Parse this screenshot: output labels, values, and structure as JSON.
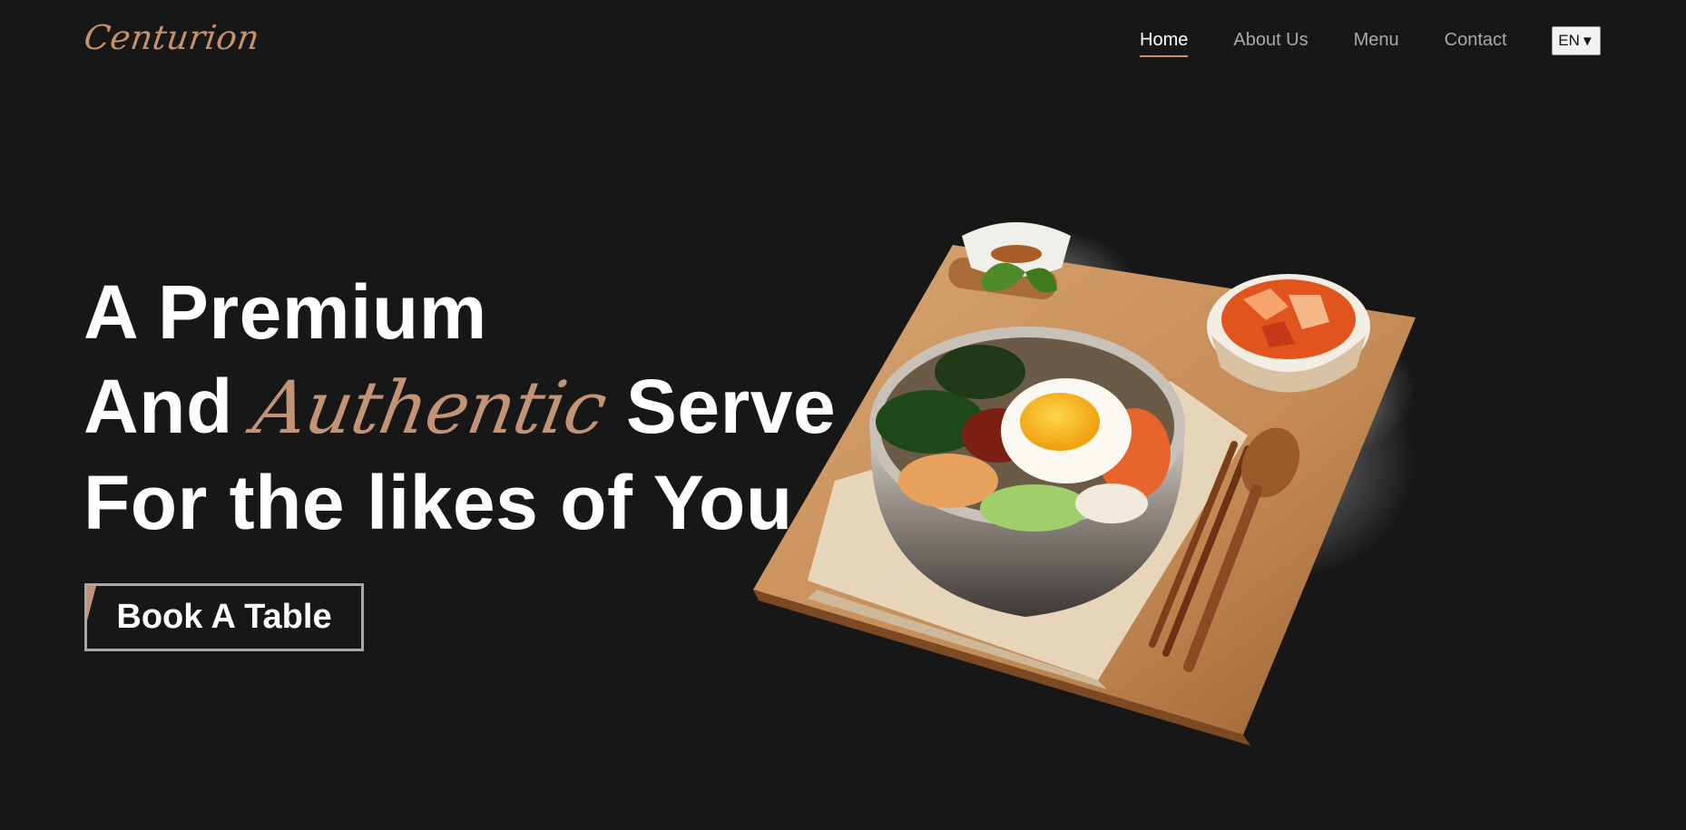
{
  "brand": {
    "name": "Centurion",
    "accent_color": "#c8916a",
    "background_color": "#171717"
  },
  "nav": {
    "items": [
      {
        "label": "Home",
        "active": true
      },
      {
        "label": "About Us",
        "active": false
      },
      {
        "label": "Menu",
        "active": false
      },
      {
        "label": "Contact",
        "active": false
      }
    ],
    "language": {
      "selected": "EN",
      "icon": "caret-down-icon"
    }
  },
  "hero": {
    "line1": "A Premium",
    "line2_prefix": "And",
    "line2_highlight": "Authentic",
    "line2_suffix": "Serve",
    "line3": "For the likes of You",
    "cta_label": "Book A Table",
    "image": {
      "subject": "bibimbap bowl with fried egg, kimchi dish, chopsticks and spoon on a wooden board"
    }
  }
}
